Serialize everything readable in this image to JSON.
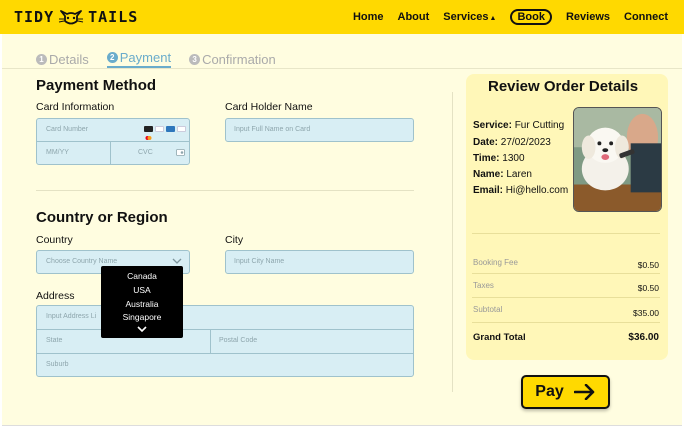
{
  "brand": {
    "left": "TIDY",
    "right": "TAILS"
  },
  "nav": {
    "home": "Home",
    "about": "About",
    "services": "Services",
    "book": "Book",
    "reviews": "Reviews",
    "connect": "Connect"
  },
  "steps": [
    {
      "num": "1",
      "label": "Details"
    },
    {
      "num": "2",
      "label": "Payment"
    },
    {
      "num": "3",
      "label": "Confirmation"
    }
  ],
  "payment": {
    "title": "Payment Method",
    "card_info_label": "Card Information",
    "card_number_placeholder": "Card Number",
    "expiry_placeholder": "MM/YY",
    "cvc_placeholder": "CVC",
    "holder_label": "Card Holder Name",
    "holder_placeholder": "Input Full Name on Card"
  },
  "region": {
    "title": "Country or Region",
    "country_label": "Country",
    "country_placeholder": "Choose Country Name",
    "city_label": "City",
    "city_placeholder": "Input City Name",
    "address_label": "Address",
    "address_placeholder": "Input Address Li",
    "state_placeholder": "State",
    "postal_placeholder": "Postal Code",
    "suburb_placeholder": "Suburb",
    "dropdown_options": [
      "Canada",
      "USA",
      "Australia",
      "Singapore"
    ]
  },
  "review": {
    "title": "Review Order Details",
    "service_label": "Service:",
    "service": "Fur Cutting",
    "date_label": "Date:",
    "date": "27/02/2023",
    "time_label": "Time:",
    "time": "1300",
    "name_label": "Name:",
    "name": "Laren",
    "email_label": "Email:",
    "email": "Hi@hello.com",
    "booking_fee_label": "Booking Fee",
    "booking_fee": "$0.50",
    "taxes_label": "Taxes",
    "taxes": "$0.50",
    "subtotal_label": "Subtotal",
    "subtotal": "$35.00",
    "grand_total_label": "Grand Total",
    "grand_total": "$36.00"
  },
  "pay_button": "Pay",
  "colors": {
    "brand_yellow": "#ffd900",
    "panel_bg": "#fffde0",
    "field_bg": "#d8eef4",
    "step_active": "#6aaccb"
  },
  "icons": [
    "cat-icon",
    "card-brand-icons",
    "cvc-card-icon",
    "chevron-down-icon",
    "arrow-right-icon"
  ]
}
